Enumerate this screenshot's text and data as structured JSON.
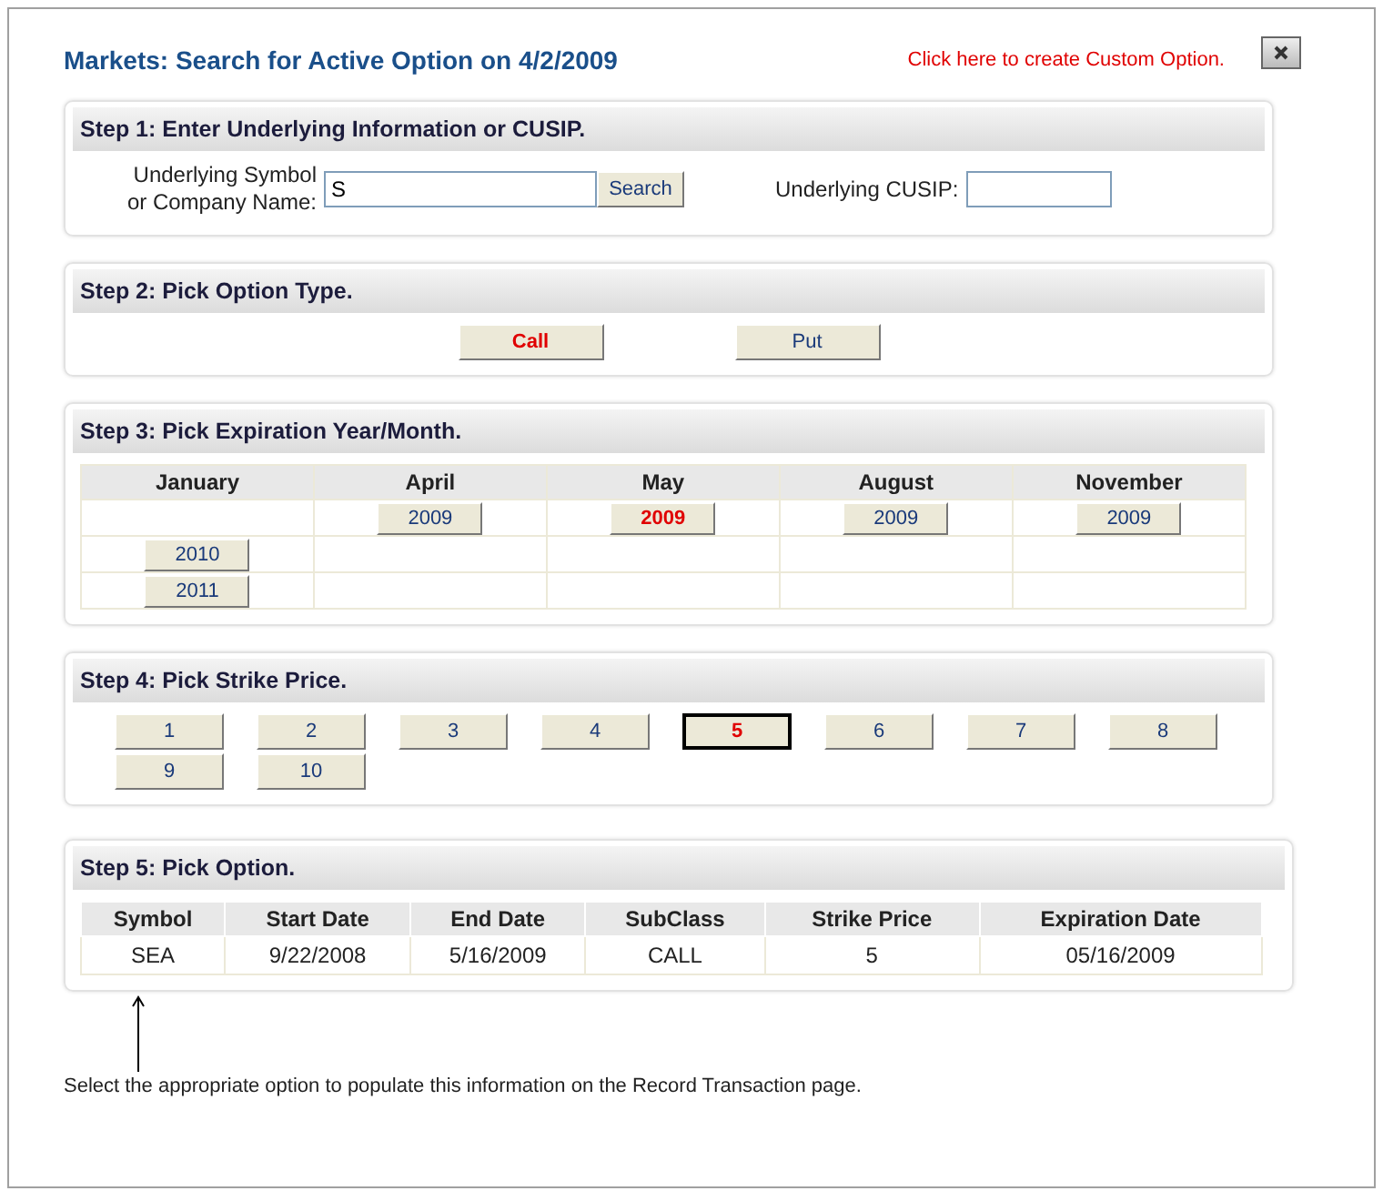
{
  "title": "Markets: Search for Active Option on 4/2/2009",
  "custom_link": "Click here to create Custom Option.",
  "step1": {
    "heading": "Step 1: Enter Underlying Information or CUSIP.",
    "symbol_label": "Underlying Symbol or Company Name:",
    "symbol_value": "S",
    "search_button": "Search",
    "cusip_label": "Underlying CUSIP:"
  },
  "step2": {
    "heading": "Step 2: Pick Option Type.",
    "types": [
      {
        "label": "Call",
        "selected": true
      },
      {
        "label": "Put",
        "selected": false
      }
    ]
  },
  "step3": {
    "heading": "Step 3: Pick Expiration Year/Month.",
    "months": [
      "January",
      "April",
      "May",
      "August",
      "November"
    ],
    "rows": [
      [
        {
          "kind": "empty"
        },
        {
          "kind": "year",
          "year": "2009",
          "selected": false
        },
        {
          "kind": "year",
          "year": "2009",
          "selected": true
        },
        {
          "kind": "year",
          "year": "2009",
          "selected": false
        },
        {
          "kind": "year",
          "year": "2009",
          "selected": false
        }
      ],
      [
        {
          "kind": "year",
          "year": "2010",
          "selected": false
        },
        {
          "kind": "empty"
        },
        {
          "kind": "empty"
        },
        {
          "kind": "empty"
        },
        {
          "kind": "empty"
        }
      ],
      [
        {
          "kind": "year",
          "year": "2011",
          "selected": false
        },
        {
          "kind": "empty"
        },
        {
          "kind": "empty"
        },
        {
          "kind": "empty"
        },
        {
          "kind": "empty"
        }
      ]
    ]
  },
  "step4": {
    "heading": "Step 4: Pick Strike Price.",
    "strikes": [
      {
        "label": "1",
        "selected": false
      },
      {
        "label": "2",
        "selected": false
      },
      {
        "label": "3",
        "selected": false
      },
      {
        "label": "4",
        "selected": false
      },
      {
        "label": "5",
        "selected": true
      },
      {
        "label": "6",
        "selected": false
      },
      {
        "label": "7",
        "selected": false
      },
      {
        "label": "8",
        "selected": false
      },
      {
        "label": "9",
        "selected": false
      },
      {
        "label": "10",
        "selected": false
      }
    ]
  },
  "step5": {
    "heading": "Step 5: Pick Option.",
    "columns": [
      "Symbol",
      "Start Date",
      "End Date",
      "SubClass",
      "Strike Price",
      "Expiration Date"
    ],
    "rows": [
      [
        "SEA",
        "9/22/2008",
        "5/16/2009",
        "CALL",
        "5",
        "05/16/2009"
      ]
    ]
  },
  "note": "Select the appropriate option to populate this information on the Record Transaction page."
}
